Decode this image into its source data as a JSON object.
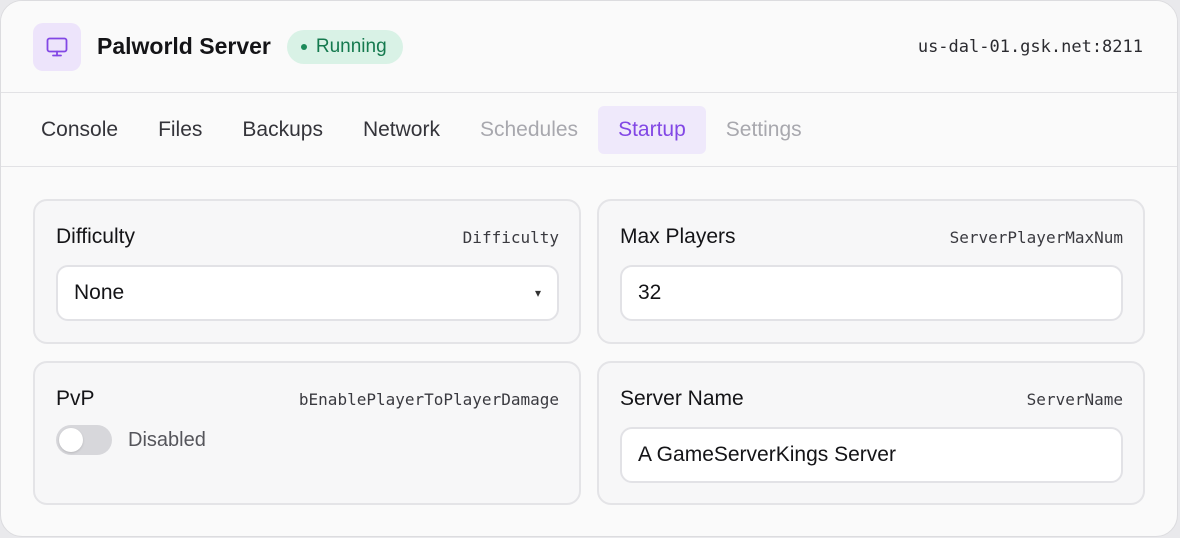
{
  "header": {
    "icon": "monitor-icon",
    "title": "Palworld Server",
    "status": "Running",
    "address": "us-dal-01.gsk.net:8211",
    "accent_color": "#8247e5",
    "status_color": "#157a4f"
  },
  "tabs": [
    {
      "label": "Console",
      "state": "normal"
    },
    {
      "label": "Files",
      "state": "normal"
    },
    {
      "label": "Backups",
      "state": "normal"
    },
    {
      "label": "Network",
      "state": "normal"
    },
    {
      "label": "Schedules",
      "state": "disabled"
    },
    {
      "label": "Startup",
      "state": "active"
    },
    {
      "label": "Settings",
      "state": "disabled"
    }
  ],
  "settings": {
    "difficulty": {
      "label": "Difficulty",
      "key": "Difficulty",
      "value": "None",
      "caret": "▾"
    },
    "max_players": {
      "label": "Max Players",
      "key": "ServerPlayerMaxNum",
      "value": "32"
    },
    "pvp": {
      "label": "PvP",
      "key": "bEnablePlayerToPlayerDamage",
      "enabled": false,
      "state_label": "Disabled"
    },
    "server_name": {
      "label": "Server Name",
      "key": "ServerName",
      "value": "A GameServerKings Server"
    }
  }
}
